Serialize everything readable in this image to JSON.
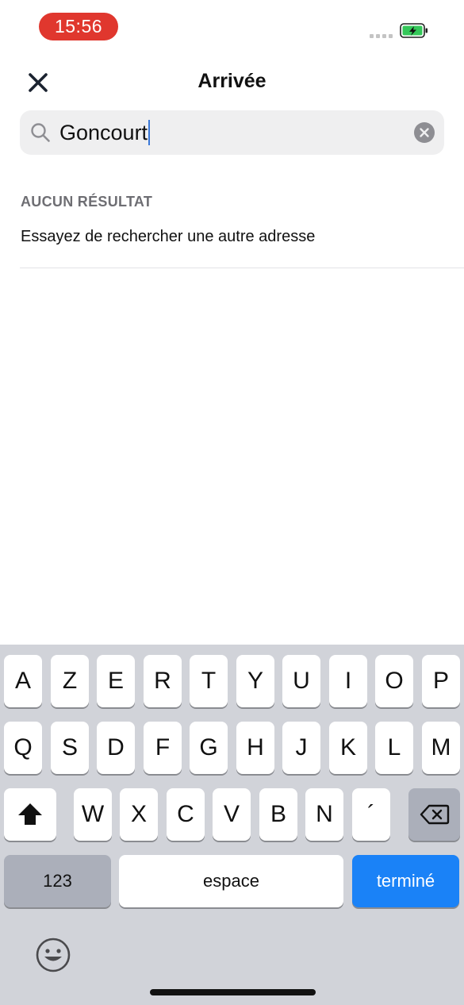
{
  "status_bar": {
    "time": "15:56",
    "recording_color": "#e0372e",
    "signal_icon": "cellular-dots-icon",
    "battery_icon": "battery-charging-icon"
  },
  "nav": {
    "close_icon": "close-icon",
    "title": "Arrivée"
  },
  "search": {
    "icon": "search-icon",
    "value": "Goncourt",
    "clear_icon": "clear-circle-icon"
  },
  "results": {
    "section_title": "AUCUN RÉSULTAT",
    "message": "Essayez de rechercher une autre adresse"
  },
  "keyboard": {
    "row1": [
      "A",
      "Z",
      "E",
      "R",
      "T",
      "Y",
      "U",
      "I",
      "O",
      "P"
    ],
    "row2": [
      "Q",
      "S",
      "D",
      "F",
      "G",
      "H",
      "J",
      "K",
      "L",
      "M"
    ],
    "row3": [
      "W",
      "X",
      "C",
      "V",
      "B",
      "N",
      "´"
    ],
    "shift_icon": "shift-icon",
    "backspace_icon": "backspace-icon",
    "numbers_label": "123",
    "space_label": "espace",
    "done_label": "terminé",
    "emoji_icon": "emoji-icon",
    "accent_color": "#1a82f7"
  }
}
